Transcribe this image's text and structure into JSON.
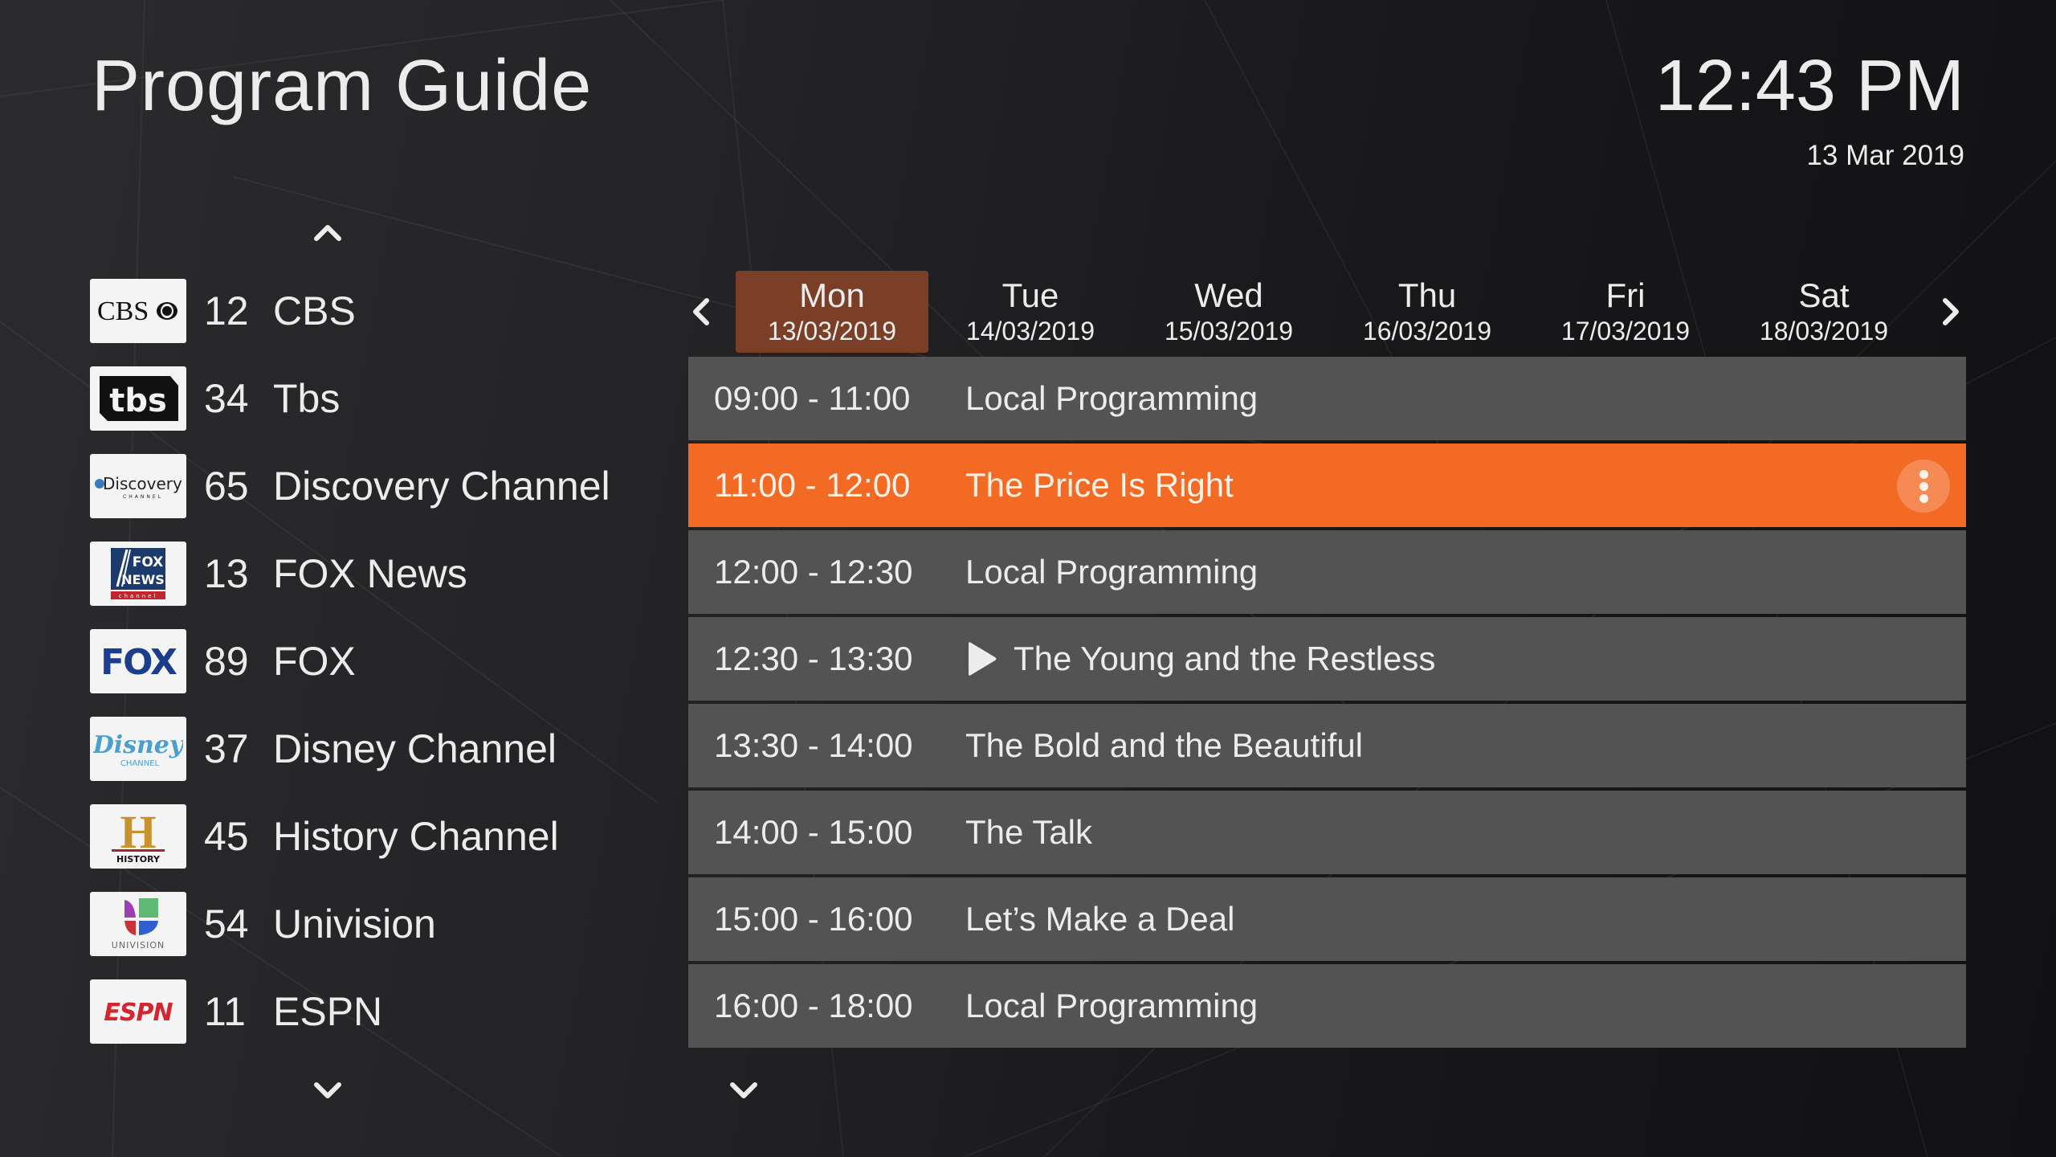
{
  "header": {
    "title": "Program Guide",
    "clock": "12:43 PM",
    "date": "13 Mar 2019"
  },
  "colors": {
    "accent_orange": "#f26a24",
    "selected_brown": "#7a3f26",
    "row_gray": "#535354",
    "text": "#ececec"
  },
  "channels": [
    {
      "number": "12",
      "name": "CBS",
      "logo": "cbs-logo",
      "logo_text": "CBS",
      "selected": true
    },
    {
      "number": "34",
      "name": "Tbs",
      "logo": "tbs-logo",
      "logo_text": "tbs",
      "selected": false
    },
    {
      "number": "65",
      "name": "Discovery Channel",
      "logo": "discovery-logo",
      "logo_text": "Discovery",
      "logo_subtext": "CHANNEL",
      "selected": false
    },
    {
      "number": "13",
      "name": "FOX News",
      "logo": "fox-news-logo",
      "logo_text": "FOX NEWS",
      "logo_subtext": "channel",
      "selected": false
    },
    {
      "number": "89",
      "name": "FOX",
      "logo": "fox-logo",
      "logo_text": "FOX",
      "selected": false
    },
    {
      "number": "37",
      "name": "Disney Channel",
      "logo": "disney-channel-logo",
      "logo_text": "Disney",
      "logo_subtext": "CHANNEL",
      "selected": false
    },
    {
      "number": "45",
      "name": "History Channel",
      "logo": "history-logo",
      "logo_text": "H",
      "logo_subtext": "HISTORY",
      "selected": false
    },
    {
      "number": "54",
      "name": "Univision",
      "logo": "univision-logo",
      "logo_subtext": "UNIVISION",
      "selected": false
    },
    {
      "number": "11",
      "name": "ESPN",
      "logo": "espn-logo",
      "logo_text": "ESPN",
      "selected": false
    }
  ],
  "days": [
    {
      "day": "Mon",
      "date": "13/03/2019",
      "selected": true
    },
    {
      "day": "Tue",
      "date": "14/03/2019",
      "selected": false
    },
    {
      "day": "Wed",
      "date": "15/03/2019",
      "selected": false
    },
    {
      "day": "Thu",
      "date": "16/03/2019",
      "selected": false
    },
    {
      "day": "Fri",
      "date": "17/03/2019",
      "selected": false
    },
    {
      "day": "Sat",
      "date": "18/03/2019",
      "selected": false
    }
  ],
  "programs": [
    {
      "time": "09:00 - 11:00",
      "title": "Local Programming",
      "selected": false,
      "playing": false
    },
    {
      "time": "11:00 - 12:00",
      "title": "The Price Is Right",
      "selected": true,
      "playing": false,
      "more_icon": "more-vertical-icon"
    },
    {
      "time": "12:00 - 12:30",
      "title": "Local Programming",
      "selected": false,
      "playing": false
    },
    {
      "time": "12:30 - 13:30",
      "title": "The Young and the Restless",
      "selected": false,
      "playing": true,
      "status_icon": "play-icon"
    },
    {
      "time": "13:30 - 14:00",
      "title": "The Bold and the Beautiful",
      "selected": false,
      "playing": false
    },
    {
      "time": "14:00 - 15:00",
      "title": "The Talk",
      "selected": false,
      "playing": false
    },
    {
      "time": "15:00 - 16:00",
      "title": "Let’s Make a Deal",
      "selected": false,
      "playing": false
    },
    {
      "time": "16:00 - 18:00",
      "title": "Local Programming",
      "selected": false,
      "playing": false
    }
  ],
  "nav_icons": {
    "channels_up": "chevron-up-icon",
    "channels_down": "chevron-down-icon",
    "days_prev": "chevron-left-icon",
    "days_next": "chevron-right-icon",
    "programs_down": "chevron-down-icon"
  }
}
